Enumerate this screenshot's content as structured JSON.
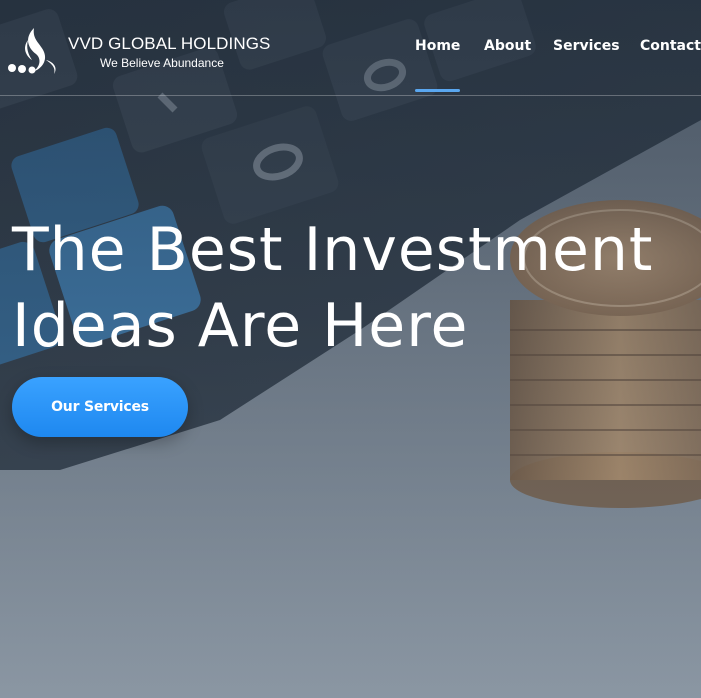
{
  "brand": {
    "name": "VVD GLOBAL HOLDINGS",
    "tagline": "We Believe Abundance"
  },
  "nav": {
    "items": [
      {
        "label": "Home",
        "active": true
      },
      {
        "label": "About",
        "active": false
      },
      {
        "label": "Services",
        "active": false
      },
      {
        "label": "Contact",
        "active": false
      }
    ]
  },
  "hero": {
    "headline_line1": "The Best Investment",
    "headline_line2": "Ideas Are Here",
    "cta_label": "Our Services"
  },
  "colors": {
    "accent": "#1e88f0",
    "nav_active_underline": "#5aa7f0",
    "text": "#ffffff"
  },
  "icons": {
    "logo": "flame-dots-logo-icon"
  }
}
